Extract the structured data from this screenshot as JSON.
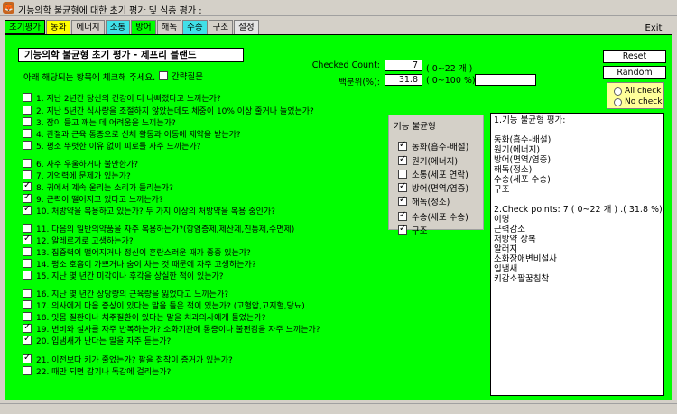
{
  "window": {
    "title": "기능의학 불균형에 대한 초기 평가 및 심층 평가 :",
    "exit_label": "Exit"
  },
  "tabs": [
    {
      "label": "초기평가"
    },
    {
      "label": "동화"
    },
    {
      "label": "에너지"
    },
    {
      "label": "소통"
    },
    {
      "label": "방어"
    },
    {
      "label": "해독"
    },
    {
      "label": "수송"
    },
    {
      "label": "구조"
    },
    {
      "label": "설정"
    }
  ],
  "main": {
    "heading": "기능의학 불균형 초기 평가 - 제프리 블랜드",
    "instruction": "아래 해당되는 항목에 체크해 주세요.",
    "guess_label": "간략질문",
    "checked_count_label": "Checked Count:",
    "checked_count_value": "7",
    "checked_count_range": "( 0~22 개 )",
    "percent_label": "백분위(%):",
    "percent_value": "31.8",
    "percent_range": "( 0~100 %)"
  },
  "questions": [
    {
      "text": "1. 지난 2년간 당신의 건강이 더 나빠졌다고 느끼는가?",
      "checked": false
    },
    {
      "text": "2. 지난 5년간 식사량을 조절하지 않았는데도 체중이 10% 이상 줄거나 늘었는가?",
      "checked": false
    },
    {
      "text": "3. 잠이 들고 깨는 데 어려움을 느끼는가?",
      "checked": false
    },
    {
      "text": "4. 관절과 근육 통증으로 신체 활동과 이동에 제약을 받는가?",
      "checked": false
    },
    {
      "text": "5. 평소 뚜렷한 이유 없이 피로를 자주 느끼는가?",
      "checked": false
    },
    {
      "text": "6. 자주 우울하거나 불안한가?",
      "checked": false
    },
    {
      "text": "7. 기억력에 문제가 있는가?",
      "checked": false
    },
    {
      "text": "8. 귀에서 계속 울리는 소리가 들리는가?",
      "checked": true
    },
    {
      "text": "9. 근력이 떨어지고 있다고 느끼는가?",
      "checked": true
    },
    {
      "text": "10. 처방약을 복용하고 있는가? 두 가지 이상의 처방약을 복용 중인가?",
      "checked": true
    },
    {
      "text": "11. 다음의 일반의약품을 자주 복용하는가?(항염증제,제산제,진통제,수면제)",
      "checked": false
    },
    {
      "text": "12. 알레르기로 고생하는가?",
      "checked": true
    },
    {
      "text": "13. 집중력이 떨어지거나 정신이 혼란스러운 때가 종종 있는가?",
      "checked": false
    },
    {
      "text": "14. 평소 호흡이 가쁘거나 숨이 차는 것 때문에 자주 고생하는가?",
      "checked": false
    },
    {
      "text": "15. 지난 몇 년간 미각이나 후각을 상실한 적이 있는가?",
      "checked": false
    },
    {
      "text": "16. 지난 몇 년간 상당량의 근육량을 잃었다고 느끼는가?",
      "checked": false
    },
    {
      "text": "17. 의사에게 다음 증상이 있다는 말을 들은 적이 있는가? (고혈압,고지혈,당뇨)",
      "checked": false
    },
    {
      "text": "18. 잇몸 질환이나 치주질환이 있다는 말을 치과의사에게 들었는가?",
      "checked": false
    },
    {
      "text": "19. 변비와 설사를 자주 반복하는가? 소화기관에 통증이나 불편감을 자주 느끼는가?",
      "checked": true
    },
    {
      "text": "20. 입냄새가 난다는 말을 자주 듣는가?",
      "checked": true
    },
    {
      "text": "21. 이전보다 키가 줄었는가? 팔을 접착이 증거가 있는가?",
      "checked": true
    },
    {
      "text": "22. 때만 되면 감기나 독감에 걸리는가?",
      "checked": false
    }
  ],
  "buttons": {
    "reset": "Reset",
    "random": "Random",
    "all_check": "All check",
    "no_check": "No check"
  },
  "organ_panel": {
    "title": "기능 불균형",
    "items": [
      {
        "label": "동화(흡수-배설)",
        "checked": true
      },
      {
        "label": "원기(에너지)",
        "checked": true
      },
      {
        "label": "소통(세포 연락)",
        "checked": false
      },
      {
        "label": "방어(면역/염증)",
        "checked": true
      },
      {
        "label": "해독(정소)",
        "checked": true
      },
      {
        "label": "수송(세포 수송)",
        "checked": true
      },
      {
        "label": "구조",
        "checked": true
      }
    ]
  },
  "result_lines": [
    "1.기능 불균형 평가:",
    "",
    "동화(흡수-배설)",
    "원기(에너지)",
    "방어(면역/염증)",
    "해독(정소)",
    "수송(세포 수송)",
    "구조",
    "",
    "2.Check points:  7 ( 0~22 개 ) .( 31.8 %)",
    "이명",
    "근력감소",
    "처방약 상복",
    "알러지",
    "소화장애변비설사",
    "입냄새",
    "키감소팔꿈침착"
  ],
  "colors": {
    "panel_green": "#00ff00",
    "tab_yellow": "#ffff00",
    "tab_cyan": "#40e0e8",
    "radio_box": "#ffff99"
  }
}
